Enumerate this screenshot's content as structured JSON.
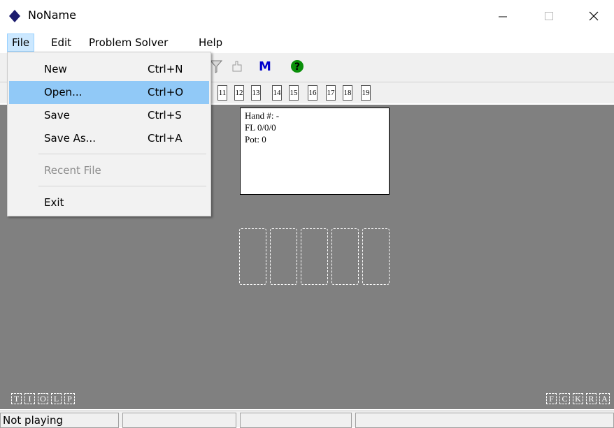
{
  "window": {
    "title": "NoName"
  },
  "menubar": {
    "items": [
      "File",
      "Edit",
      "Problem Solver",
      "Help"
    ]
  },
  "file_menu": {
    "items": [
      {
        "label": "New",
        "shortcut": "Ctrl+N"
      },
      {
        "label": "Open...",
        "shortcut": "Ctrl+O"
      },
      {
        "label": "Save",
        "shortcut": "Ctrl+S"
      },
      {
        "label": "Save As...",
        "shortcut": "Ctrl+A"
      },
      {
        "label": "Recent File",
        "shortcut": ""
      },
      {
        "label": "Exit",
        "shortcut": ""
      }
    ]
  },
  "toolbar": {
    "m_label": "M"
  },
  "seats": [
    "11",
    "12",
    "13",
    "14",
    "15",
    "16",
    "17",
    "18",
    "19"
  ],
  "hand_info": {
    "hand": "Hand #: -",
    "fl": "FL 0/0/0",
    "pot": "Pot: 0"
  },
  "left_buttons": [
    "T",
    "I",
    "O",
    "L",
    "P"
  ],
  "right_buttons": [
    "F",
    "C",
    "K",
    "R",
    "A"
  ],
  "status": {
    "text": "Not playing"
  },
  "colors": {
    "table": "#808080",
    "highlight": "#91c9f7",
    "menu_active": "#cce8ff",
    "m_blue": "#0000cc",
    "help_green": "#008000"
  }
}
